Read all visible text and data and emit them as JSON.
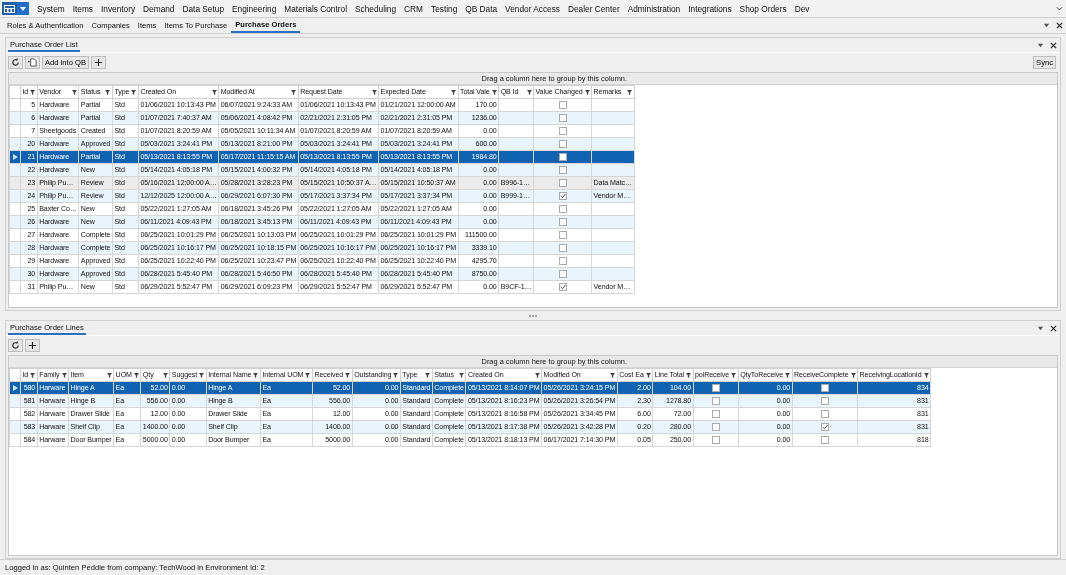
{
  "menu": [
    {
      "label": "System"
    },
    {
      "label": "Items"
    },
    {
      "label": "Inventory"
    },
    {
      "label": "Demand"
    },
    {
      "label": "Data Setup"
    },
    {
      "label": "Engineering"
    },
    {
      "label": "Materials Control"
    },
    {
      "label": "Scheduling"
    },
    {
      "label": "CRM"
    },
    {
      "label": "Testing"
    },
    {
      "label": "QB Data"
    },
    {
      "label": "Vendor Access"
    },
    {
      "label": "Dealer Center"
    },
    {
      "label": "Administration"
    },
    {
      "label": "Integrations"
    },
    {
      "label": "Shop Orders"
    },
    {
      "label": "Dev"
    }
  ],
  "subtabs": [
    {
      "label": "Roles & Authentication",
      "selected": false
    },
    {
      "label": "Companies",
      "selected": false
    },
    {
      "label": "Items",
      "selected": false
    },
    {
      "label": "Items To Purchase",
      "selected": false
    },
    {
      "label": "Purchase Orders",
      "selected": true
    }
  ],
  "po_list": {
    "title": "Purchase Order List",
    "add_button": "Add into QB",
    "sync_button": "Sync",
    "group_hint": "Drag a column here to group by this column.",
    "columns": [
      {
        "label": "Id",
        "kind": "number"
      },
      {
        "label": "Vendor",
        "kind": "text"
      },
      {
        "label": "Status",
        "kind": "text"
      },
      {
        "label": "Type",
        "kind": "text"
      },
      {
        "label": "Created On",
        "kind": "text"
      },
      {
        "label": "Modified At",
        "kind": "text"
      },
      {
        "label": "Request Date",
        "kind": "text"
      },
      {
        "label": "Expected Date",
        "kind": "text"
      },
      {
        "label": "Total Vale",
        "kind": "number"
      },
      {
        "label": "QB Id",
        "kind": "text"
      },
      {
        "label": "Value Changed",
        "kind": "check"
      },
      {
        "label": "Remarks",
        "kind": "text"
      }
    ],
    "rows": [
      {
        "cells": [
          "5",
          "Hardware",
          "Partial",
          "Std",
          "01/06/2021 10:13:43 PM",
          "06/07/2021 9:24:33 AM",
          "01/06/2021 10:13:43 PM",
          "01/21/2021 12:00:00 AM",
          "170.00",
          null,
          false,
          null
        ],
        "selected": false,
        "hovered": false
      },
      {
        "cells": [
          "6",
          "Hardware",
          "Partial",
          "Std",
          "01/07/2021 7:40:37 AM",
          "05/06/2021 4:08:42 PM",
          "02/21/2021 2:31:05 PM",
          "02/21/2021 2:31:05 PM",
          "1236.00",
          null,
          false,
          null
        ],
        "selected": false,
        "hovered": false
      },
      {
        "cells": [
          "7",
          "Sheetgoods",
          "Created",
          "Std",
          "01/07/2021 8:20:59 AM",
          "05/05/2021 10:11:34 AM",
          "01/07/2021 8:20:59 AM",
          "01/07/2021 8:20:59 AM",
          "0.00",
          null,
          false,
          null
        ],
        "selected": false,
        "hovered": false
      },
      {
        "cells": [
          "20",
          "Hardware",
          "Approved",
          "Std",
          "05/03/2021 3:24:41 PM",
          "05/13/2021 8:21:00 PM",
          "05/03/2021 3:24:41 PM",
          "05/03/2021 3:24:41 PM",
          "600.00",
          null,
          false,
          null
        ],
        "selected": false,
        "hovered": false
      },
      {
        "cells": [
          "21",
          "Hardware",
          "Partial",
          "Std",
          "05/13/2021 8:13:55 PM",
          "05/17/2021 11:15:15 AM",
          "05/13/2021 8:13:55 PM",
          "05/13/2021 8:13:55 PM",
          "1984.80",
          null,
          false,
          null
        ],
        "selected": true,
        "hovered": false
      },
      {
        "cells": [
          "22",
          "Hardware",
          "New",
          "Std",
          "05/14/2021 4:05:18 PM",
          "05/15/2021 4:00:32 PM",
          "05/14/2021 4:05:18 PM",
          "05/14/2021 4:05:18 PM",
          "0.00",
          null,
          false,
          null
        ],
        "selected": false,
        "hovered": false
      },
      {
        "cells": [
          "23",
          "Philip Pu…",
          "Review",
          "Std",
          "05/16/2021 12:00:00 A…",
          "05/28/2021 3:28:23 PM",
          "05/15/2021 10:50:37 A…",
          "05/15/2021 10:50:37 AM",
          "0.00",
          "B996-1…",
          false,
          "Data Matc…"
        ],
        "selected": false,
        "hovered": true
      },
      {
        "cells": [
          "24",
          "Philip Pu…",
          "Review",
          "Std",
          "12/12/2025 12:00:00 A…",
          "06/29/2021 6:07:30 PM",
          "05/17/2021 3:37:34 PM",
          "05/17/2021 3:37:34 PM",
          "0.00",
          "B999-1…",
          true,
          "Vendor M…"
        ],
        "selected": false,
        "hovered": false
      },
      {
        "cells": [
          "25",
          "Baxter Co…",
          "New",
          "Std",
          "05/22/2021 1:27:05 AM",
          "06/18/2021 3:45:26 PM",
          "05/22/2021 1:27:05 AM",
          "05/22/2021 1:27:05 AM",
          "0.00",
          null,
          false,
          null
        ],
        "selected": false,
        "hovered": false
      },
      {
        "cells": [
          "26",
          "Hardware",
          "New",
          "Std",
          "06/11/2021 4:09:43 PM",
          "06/18/2021 3:45:13 PM",
          "06/11/2021 4:09:43 PM",
          "06/11/2021 4:09:43 PM",
          "0.00",
          null,
          false,
          null
        ],
        "selected": false,
        "hovered": false
      },
      {
        "cells": [
          "27",
          "Hardware",
          "Complete",
          "Std",
          "06/25/2021 10:01:29 PM",
          "06/25/2021 10:13:03 PM",
          "06/25/2021 10:01:29 PM",
          "06/25/2021 10:01:29 PM",
          "111500.00",
          null,
          false,
          null
        ],
        "selected": false,
        "hovered": false
      },
      {
        "cells": [
          "28",
          "Hardware",
          "Complete",
          "Std",
          "06/25/2021 10:16:17 PM",
          "06/25/2021 10:18:15 PM",
          "06/25/2021 10:16:17 PM",
          "06/25/2021 10:16:17 PM",
          "3339.10",
          null,
          false,
          null
        ],
        "selected": false,
        "hovered": false
      },
      {
        "cells": [
          "29",
          "Hardware",
          "Approved",
          "Std",
          "06/25/2021 10:22:40 PM",
          "06/25/2021 10:23:47 PM",
          "06/25/2021 10:22:40 PM",
          "06/25/2021 10:22:40 PM",
          "4295.70",
          null,
          false,
          null
        ],
        "selected": false,
        "hovered": false
      },
      {
        "cells": [
          "30",
          "Hardware",
          "Approved",
          "Std",
          "06/28/2021 5:45:40 PM",
          "06/28/2021 5:46:50 PM",
          "06/28/2021 5:45:40 PM",
          "06/28/2021 5:45:40 PM",
          "8750.00",
          null,
          false,
          null
        ],
        "selected": false,
        "hovered": false
      },
      {
        "cells": [
          "31",
          "Philip Pu…",
          "New",
          "Std",
          "06/29/2021 5:52:47 PM",
          "06/29/2021 6:09:23 PM",
          "06/29/2021 5:52:47 PM",
          "06/29/2021 5:52:47 PM",
          "0.00",
          "B9CF-1…",
          true,
          "Vendor M…"
        ],
        "selected": false,
        "hovered": false
      }
    ]
  },
  "po_lines": {
    "title": "Purchase Order Lines",
    "group_hint": "Drag a column here to group by this column.",
    "columns": [
      {
        "label": "Id",
        "kind": "number"
      },
      {
        "label": "Family",
        "kind": "text"
      },
      {
        "label": "Item",
        "kind": "text"
      },
      {
        "label": "UOM",
        "kind": "text"
      },
      {
        "label": "Qty",
        "kind": "number"
      },
      {
        "label": "Suggest",
        "kind": "text"
      },
      {
        "label": "Internal Name",
        "kind": "text"
      },
      {
        "label": "Internal UOM",
        "kind": "text"
      },
      {
        "label": "Received",
        "kind": "number"
      },
      {
        "label": "Outstanding",
        "kind": "number"
      },
      {
        "label": "Type",
        "kind": "text"
      },
      {
        "label": "Status",
        "kind": "text"
      },
      {
        "label": "Created On",
        "kind": "text"
      },
      {
        "label": "Modified On",
        "kind": "text"
      },
      {
        "label": "Cost Ea",
        "kind": "number"
      },
      {
        "label": "Line Total",
        "kind": "number"
      },
      {
        "label": "polReceive",
        "kind": "check"
      },
      {
        "label": "QtyToReceive",
        "kind": "number"
      },
      {
        "label": "ReceiveComplete",
        "kind": "check"
      },
      {
        "label": "ReceivingLocationId",
        "kind": "number"
      }
    ],
    "rows": [
      {
        "cells": [
          "580",
          "Harware",
          "Hinge A",
          "Ea",
          "52.00",
          "0.00",
          "Hinge A",
          "Ea",
          "52.00",
          "0.00",
          "Standard",
          "Complete",
          "05/13/2021 8:14:07 PM",
          "05/26/2021 3:24:15 PM",
          "2.00",
          "104.00",
          false,
          "0.00",
          false,
          "834"
        ],
        "selected": true,
        "hovered": false
      },
      {
        "cells": [
          "581",
          "Harware",
          "Hinge B",
          "Ea",
          "556.00",
          "0.00",
          "Hinge B",
          "Ea",
          "556.00",
          "0.00",
          "Standard",
          "Complete",
          "05/13/2021 8:16:23 PM",
          "05/26/2021 3:26:54 PM",
          "2.30",
          "1278.80",
          false,
          "0.00",
          false,
          "831"
        ],
        "selected": false,
        "hovered": false
      },
      {
        "cells": [
          "582",
          "Harware",
          "Drawer Slide",
          "Ea",
          "12.00",
          "0.00",
          "Drawer Slide",
          "Ea",
          "12.00",
          "0.00",
          "Standard",
          "Complete",
          "05/13/2021 8:16:58 PM",
          "05/26/2021 3:34:45 PM",
          "6.00",
          "72.00",
          false,
          "0.00",
          false,
          "831"
        ],
        "selected": false,
        "hovered": false
      },
      {
        "cells": [
          "583",
          "Harware",
          "Shelf Clip",
          "Ea",
          "1400.00",
          "0.00",
          "Shelf Clip",
          "Ea",
          "1400.00",
          "0.00",
          "Standard",
          "Complete",
          "05/13/2021 8:17:38 PM",
          "05/26/2021 3:42:28 PM",
          "0.20",
          "280.00",
          false,
          "0.00",
          true,
          "831"
        ],
        "selected": false,
        "hovered": false
      },
      {
        "cells": [
          "584",
          "Harware",
          "Door Bumper",
          "Ea",
          "5000.00",
          "0.00",
          "Door Bumper",
          "Ea",
          "5000.00",
          "0.00",
          "Standard",
          "Complete",
          "05/13/2021 8:18:13 PM",
          "06/17/2021 7:14:30 PM",
          "0.05",
          "250.00",
          false,
          "0.00",
          false,
          "818"
        ],
        "selected": false,
        "hovered": false
      }
    ]
  },
  "status_bar": "Logged in as: Quinten Peddie  from company: TechWood in Environment Id: 2"
}
